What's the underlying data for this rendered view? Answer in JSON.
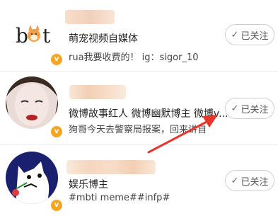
{
  "users": [
    {
      "bio": "萌宠视频自媒体",
      "description": "rua我要收费的！   ig：sigor_10",
      "follow_label": "已关注",
      "logo_text": "b t"
    },
    {
      "bio": "微博故事红人 微博幽默博主 微博v...",
      "description": "狗哥今天去警察局报案，回来讲自",
      "follow_label": "已关注"
    },
    {
      "bio": "娱乐博主",
      "description": "#mbti meme##infp#",
      "follow_label": "已关注"
    }
  ],
  "icons": {
    "verified": "verified-v-icon",
    "check": "check-icon"
  },
  "colors": {
    "verified_badge": "#f5a623",
    "annotation_arrow": "#e8362d",
    "blur_name": "#f3c9a6"
  },
  "badge_letter": "v",
  "check_glyph": "✓"
}
